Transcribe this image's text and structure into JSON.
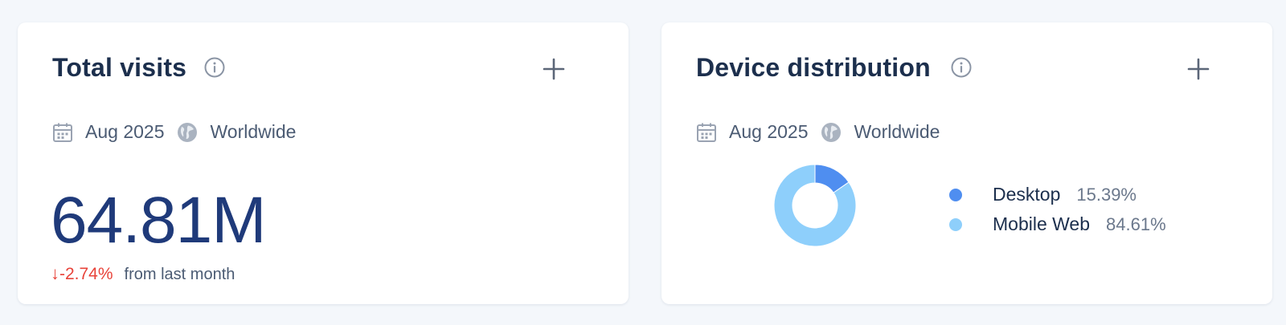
{
  "cards": {
    "visits": {
      "title": "Total visits",
      "date": "Aug 2025",
      "region": "Worldwide",
      "value": "64.81M",
      "change": "-2.74%",
      "change_label": "from last month",
      "info_icon": "info-circle-icon",
      "add_icon": "plus-icon"
    },
    "devices": {
      "title": "Device distribution",
      "date": "Aug 2025",
      "region": "Worldwide",
      "info_icon": "info-circle-icon",
      "add_icon": "plus-icon"
    }
  },
  "colors": {
    "title": "#1c2f4d",
    "big_number": "#1f3a7a",
    "negative": "#e8433a",
    "desktop": "#4f8ef0",
    "mobile_web": "#8ecffb"
  },
  "chart_data": {
    "type": "pie",
    "categories": [
      "Desktop",
      "Mobile Web"
    ],
    "values": [
      15.39,
      84.61
    ],
    "value_labels": [
      "15.39%",
      "84.61%"
    ],
    "legend_position": "right",
    "title": ""
  }
}
